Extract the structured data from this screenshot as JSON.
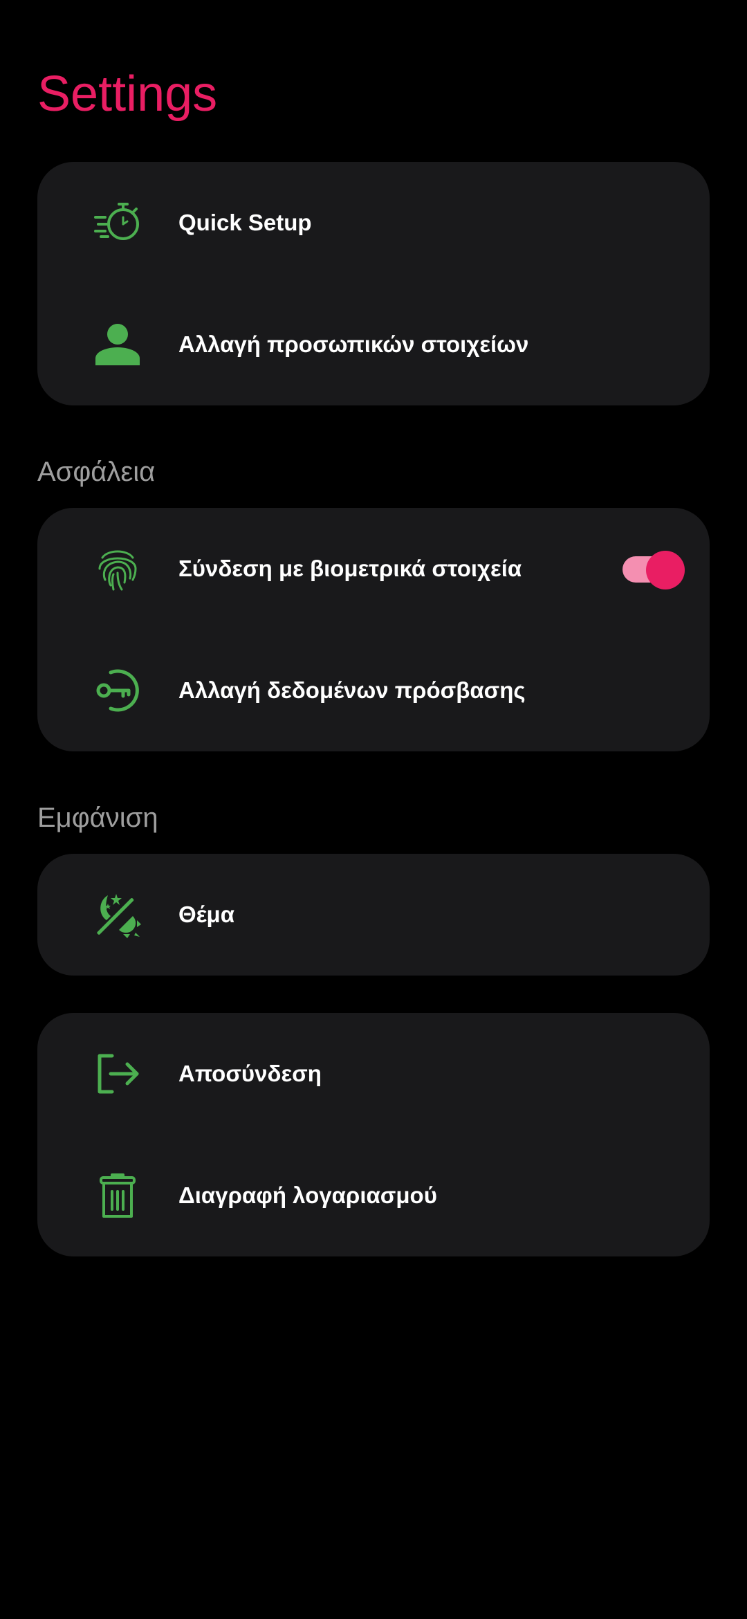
{
  "header": {
    "title": "Settings"
  },
  "colors": {
    "accent": "#E91E63",
    "icon": "#4CAF50",
    "card": "#19191B",
    "background": "#000000",
    "toggle_track": "#F48FB1"
  },
  "groups": [
    {
      "section": "",
      "items": [
        {
          "label": "Quick Setup",
          "icon": "timer-fast-icon"
        },
        {
          "label": "Αλλαγή προσωπικών στοιχείων",
          "icon": "person-icon"
        }
      ]
    },
    {
      "section": "Ασφάλεια",
      "items": [
        {
          "label": "Σύνδεση με βιομετρικά στοιχεία",
          "icon": "fingerprint-icon",
          "toggle": true
        },
        {
          "label": "Αλλαγή δεδομένων πρόσβασης",
          "icon": "key-icon"
        }
      ]
    },
    {
      "section": "Εμφάνιση",
      "items": [
        {
          "label": "Θέμα",
          "icon": "theme-day-night-icon"
        }
      ]
    },
    {
      "section": "",
      "items": [
        {
          "label": "Αποσύνδεση",
          "icon": "logout-icon"
        },
        {
          "label": "Διαγραφή λογαριασμού",
          "icon": "trash-icon"
        }
      ]
    }
  ]
}
